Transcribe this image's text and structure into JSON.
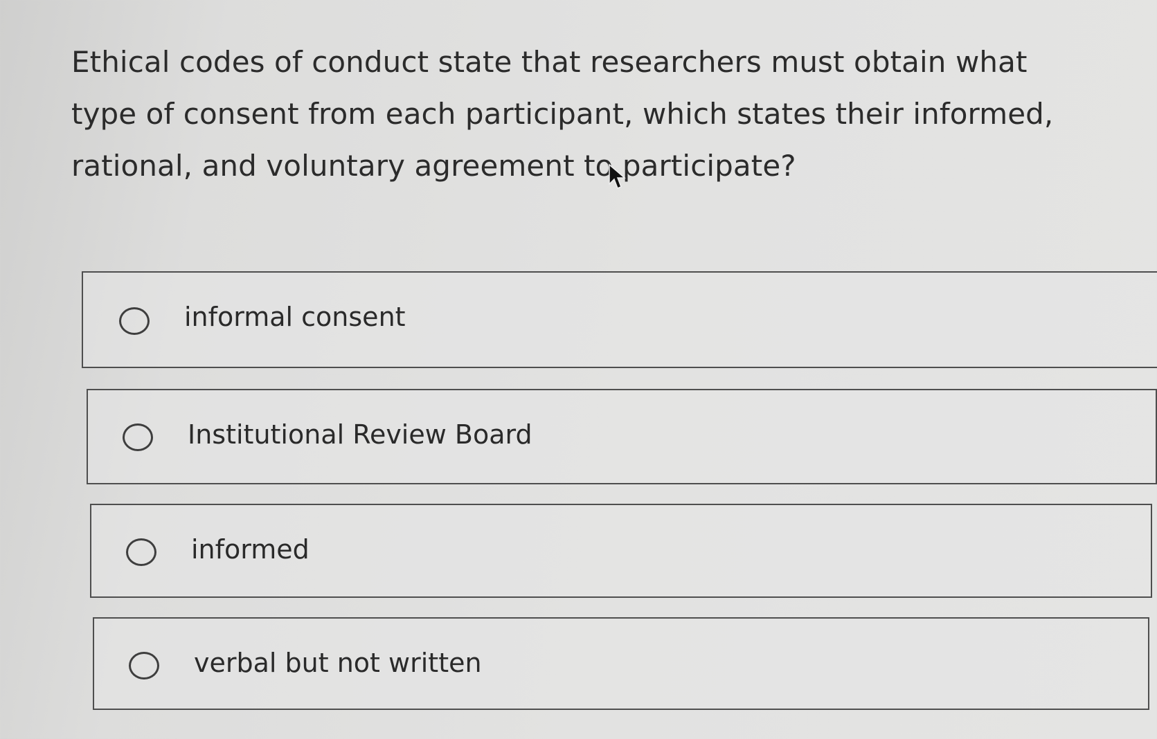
{
  "question": {
    "text": "Ethical codes of conduct state that researchers must obtain what type of consent from each participant, which states their informed, rational, and voluntary agreement to participate?"
  },
  "options": [
    {
      "label": "informal consent",
      "selected": false
    },
    {
      "label": "Institutional Review Board",
      "selected": false
    },
    {
      "label": "informed",
      "selected": false
    },
    {
      "label": "verbal but not written",
      "selected": false
    }
  ],
  "colors": {
    "background": "#e0e0df",
    "border": "#4e4e4e",
    "text": "#2a2a2a"
  },
  "icons": {
    "cursor": "mouse-pointer-icon",
    "radio": "radio-unchecked-icon"
  }
}
